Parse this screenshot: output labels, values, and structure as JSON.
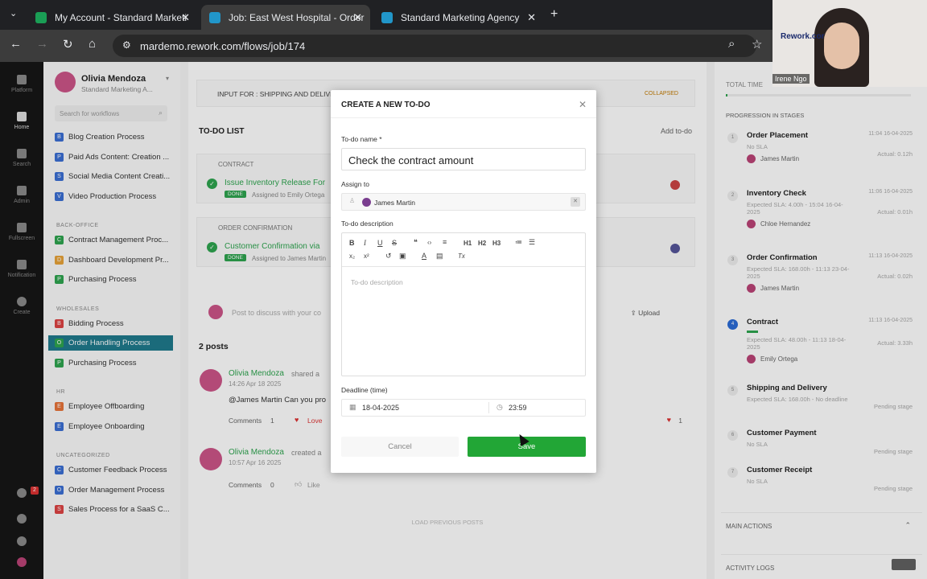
{
  "tabs": [
    {
      "title": "My Account - Standard Marketi",
      "active": false,
      "color": "#1a9e55"
    },
    {
      "title": "Job: East West Hospital - Order",
      "active": true,
      "color": "#2196c9"
    },
    {
      "title": "Standard Marketing Agency",
      "active": false,
      "color": "#2196c9"
    }
  ],
  "url": "mardemo.rework.com/flows/job/174",
  "rail": {
    "items": [
      "Platform",
      "Home",
      "Search",
      "Admin",
      "Fullscreen",
      "Notification",
      "Create"
    ],
    "badge": "2"
  },
  "sidebar": {
    "user_name": "Olivia Mendoza",
    "org": "Standard Marketing A...",
    "search_placeholder": "Search for workflows",
    "groups": [
      {
        "label": "",
        "items": [
          {
            "label": "Blog Creation Process",
            "color": "#3b6fd4",
            "ic": "B"
          },
          {
            "label": "Paid Ads Content: Creation ...",
            "color": "#3b6fd4",
            "ic": "P"
          },
          {
            "label": "Social Media Content Creati...",
            "color": "#3b6fd4",
            "ic": "S"
          },
          {
            "label": "Video Production Process",
            "color": "#3b6fd4",
            "ic": "V"
          }
        ]
      },
      {
        "label": "BACK-OFFICE",
        "items": [
          {
            "label": "Contract Management Proc...",
            "color": "#2ea44f",
            "ic": "C"
          },
          {
            "label": "Dashboard Development Pr...",
            "color": "#e8a33a",
            "ic": "D"
          },
          {
            "label": "Purchasing Process",
            "color": "#2ea44f",
            "ic": "P"
          }
        ]
      },
      {
        "label": "WHOLESALES",
        "items": [
          {
            "label": "Bidding Process",
            "color": "#d44",
            "ic": "B"
          },
          {
            "label": "Order Handling Process",
            "color": "#2ea44f",
            "ic": "O",
            "active": true
          },
          {
            "label": "Purchasing Process",
            "color": "#2ea44f",
            "ic": "P"
          }
        ]
      },
      {
        "label": "HR",
        "items": [
          {
            "label": "Employee Offboarding",
            "color": "#e8733a",
            "ic": "E"
          },
          {
            "label": "Employee Onboarding",
            "color": "#3b6fd4",
            "ic": "E"
          }
        ]
      },
      {
        "label": "UNCATEGORIZED",
        "items": [
          {
            "label": "Customer Feedback Process",
            "color": "#3b6fd4",
            "ic": "C"
          },
          {
            "label": "Order Management Process",
            "color": "#3b6fd4",
            "ic": "O"
          },
          {
            "label": "Sales Process for a SaaS C...",
            "color": "#d44",
            "ic": "S"
          }
        ]
      }
    ]
  },
  "main": {
    "input_for": "INPUT FOR : SHIPPING AND DELIVE",
    "collapsed": "COLLAPSED",
    "todo_title": "TO-DO LIST",
    "add_todo": "Add to-do",
    "contract_label": "CONTRACT",
    "contract_task": "Issue Inventory Release For",
    "contract_assigned": "Assigned to Emily Ortega",
    "order_conf_label": "ORDER CONFIRMATION",
    "order_conf_task": "Customer Confirmation via",
    "order_conf_assigned": "Assigned to James Martin",
    "done": "DONE",
    "post_placeholder": "Post to discuss with your co",
    "upload": "Upload",
    "posts_count": "2 posts",
    "post1_author": "Olivia Mendoza",
    "post1_action": "shared a",
    "post1_time": "14:26 Apr 18 2025",
    "post1_text": "@James Martin Can you pro",
    "post1_comments": "Comments",
    "post1_comments_n": "1",
    "post1_love": "Love",
    "post1_love_n": "1",
    "post2_author": "Olivia Mendoza",
    "post2_action": "created a",
    "post2_time": "10:57 Apr 16 2025",
    "post2_comments": "Comments",
    "post2_comments_n": "0",
    "post2_like": "Like",
    "load_prev": "LOAD PREVIOUS POSTS"
  },
  "right": {
    "total_time": "TOTAL TIME",
    "progression": "PROGRESSION IN STAGES",
    "main_actions": "MAIN ACTIONS",
    "activity_logs": "ACTIVITY LOGS",
    "stages": [
      {
        "num": "1",
        "name": "Order Placement",
        "date": "11:04 16-04-2025",
        "meta": "No SLA",
        "actual": "Actual: 0.12h",
        "person": "James Martin"
      },
      {
        "num": "2",
        "name": "Inventory Check",
        "date": "11:06 16-04-2025",
        "meta": "Expected SLA: 4.00h - 15:04 16-04-2025",
        "actual": "Actual: 0.01h",
        "person": "Chloe Hernandez"
      },
      {
        "num": "3",
        "name": "Order Confirmation",
        "date": "11:13 16-04-2025",
        "meta": "Expected SLA: 168.00h - 11:13 23-04-2025",
        "actual": "Actual: 0.02h",
        "person": "James Martin"
      },
      {
        "num": "4",
        "name": "Contract",
        "date": "11:13 16-04-2025",
        "meta": "Expected SLA: 48.00h - 11:13 18-04-2025",
        "actual": "Actual: 3.33h",
        "person": "Emily Ortega"
      },
      {
        "num": "5",
        "name": "Shipping and Delivery",
        "date": "",
        "meta": "Expected SLA: 168.00h - No deadline",
        "actual": "Pending stage",
        "person": ""
      },
      {
        "num": "6",
        "name": "Customer Payment",
        "date": "",
        "meta": "No SLA",
        "actual": "Pending stage",
        "person": ""
      },
      {
        "num": "7",
        "name": "Customer Receipt",
        "date": "",
        "meta": "No SLA",
        "actual": "Pending stage",
        "person": ""
      }
    ]
  },
  "modal": {
    "title": "CREATE A NEW TO-DO",
    "name_label": "To-do name *",
    "name_value": "Check the contract amount",
    "assign_label": "Assign to",
    "assignee": "James Martin",
    "desc_label": "To-do description",
    "desc_placeholder": "To-do description",
    "toolbar_row1": [
      "B",
      "I",
      "U",
      "S",
      "❝",
      "‹›",
      "≡",
      "H1",
      "H2",
      "H3",
      "≔",
      "☰"
    ],
    "toolbar_row2": [
      "x₂",
      "x²",
      "↺",
      "▣",
      "A",
      "▤",
      "Tx"
    ],
    "deadline_label": "Deadline (time)",
    "deadline_date": "18-04-2025",
    "deadline_time": "23:59",
    "cancel": "Cancel",
    "save": "Save"
  },
  "camera": {
    "name": "Irene Ngo",
    "brand": "Rework.cor"
  }
}
